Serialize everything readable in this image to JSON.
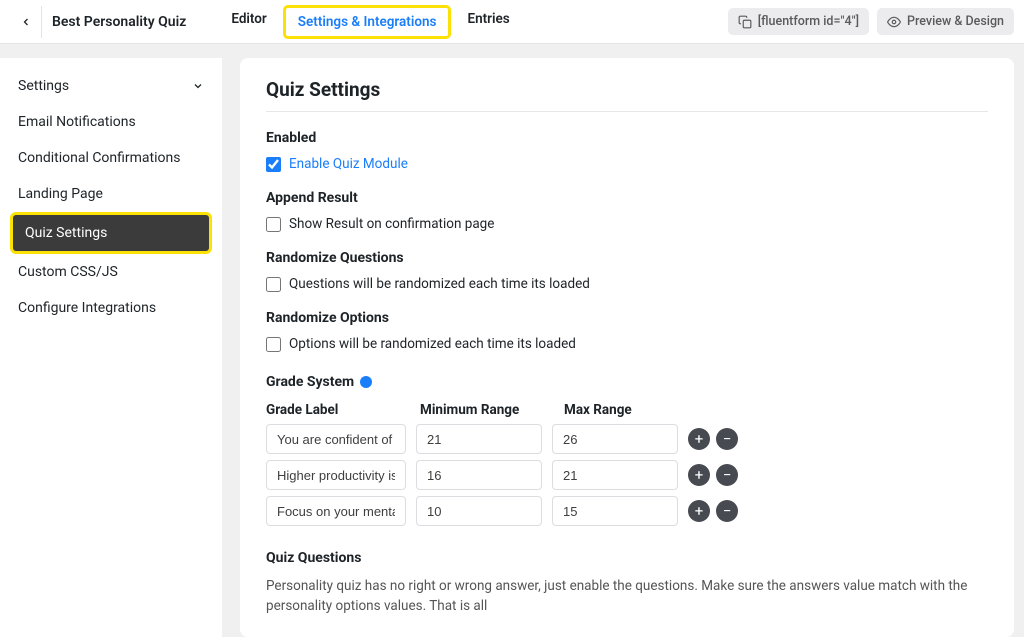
{
  "header": {
    "form_title": "Best Personality Quiz",
    "tabs": {
      "editor": "Editor",
      "settings": "Settings & Integrations",
      "entries": "Entries"
    },
    "shortcode": "[fluentform id=\"4\"]",
    "preview": "Preview & Design"
  },
  "sidebar": {
    "settings": "Settings",
    "email": "Email Notifications",
    "conditional": "Conditional Confirmations",
    "landing": "Landing Page",
    "quiz": "Quiz Settings",
    "custom": "Custom CSS/JS",
    "configure": "Configure Integrations"
  },
  "panel": {
    "title": "Quiz Settings",
    "enabled_title": "Enabled",
    "enabled_label": "Enable Quiz Module",
    "append_title": "Append Result",
    "append_label": "Show Result on confirmation page",
    "rand_q_title": "Randomize Questions",
    "rand_q_label": "Questions will be randomized each time its loaded",
    "rand_o_title": "Randomize Options",
    "rand_o_label": "Options will be randomized each time its loaded",
    "grade_title": "Grade System",
    "grade_headers": {
      "label": "Grade Label",
      "min": "Minimum Range",
      "max": "Max Range"
    },
    "grades": [
      {
        "label": "You are confident of you",
        "min": "21",
        "max": "26"
      },
      {
        "label": "Higher productivity is yo",
        "min": "16",
        "max": "21"
      },
      {
        "label": "Focus on your mental he",
        "min": "10",
        "max": "15"
      }
    ],
    "quiz_q_title": "Quiz Questions",
    "quiz_q_desc": "Personality quiz has no right or wrong answer, just enable the questions. Make sure the answers value match with the personality options values. That is all"
  }
}
